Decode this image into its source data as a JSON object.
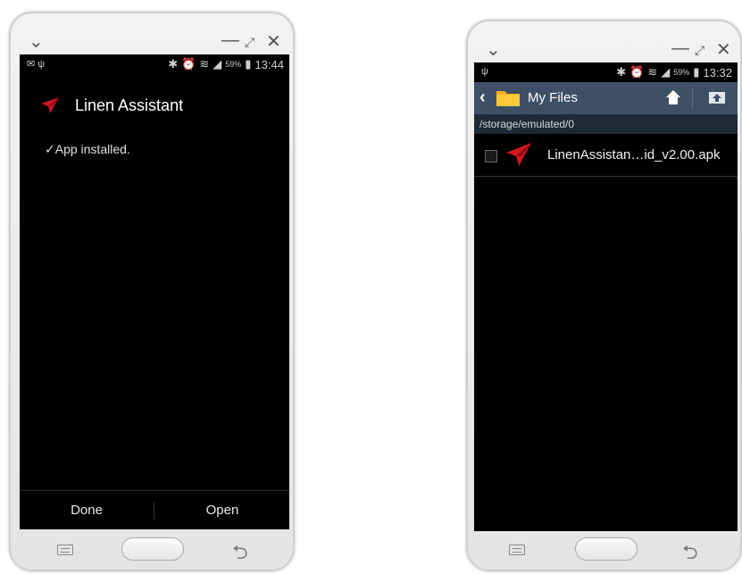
{
  "window_controls": {
    "minimize": "—",
    "maximize": "⤢",
    "close": "✕",
    "collapse": "⌄"
  },
  "phone_a": {
    "status": {
      "time": "13:44",
      "battery": "59%"
    },
    "app": {
      "title": "Linen Assistant",
      "message": "✓App installed."
    },
    "buttons": {
      "done": "Done",
      "open": "Open"
    }
  },
  "phone_b": {
    "status": {
      "time": "13:32",
      "battery": "59%"
    },
    "header": {
      "title": "My Files"
    },
    "path": "/storage/emulated/0",
    "files": [
      {
        "name": "LinenAssistan…id_v2.00.apk",
        "checked": false
      }
    ]
  },
  "colors": {
    "accent_red": "#d0161f",
    "action_bar": "#3d5066",
    "folder_yellow": "#f6b21c"
  }
}
